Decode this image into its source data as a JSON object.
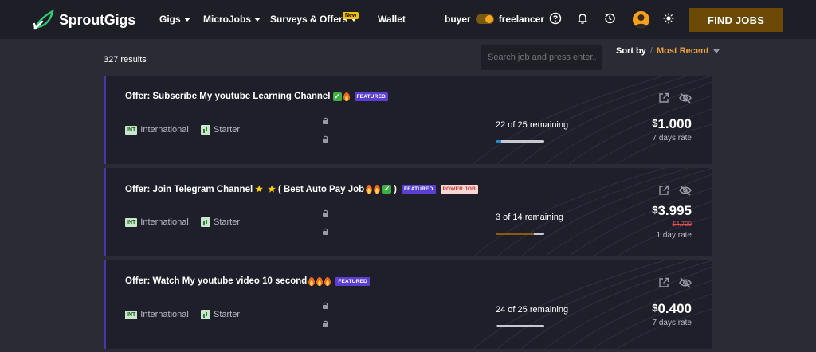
{
  "brand": {
    "name_part1": "Sprout",
    "name_part2": "Gigs"
  },
  "nav": [
    {
      "label": "Gigs",
      "dropdown": true
    },
    {
      "label": "MicroJobs",
      "dropdown": true
    },
    {
      "label": "Surveys & Offers",
      "dropdown": true,
      "badge": "New"
    },
    {
      "label": "Wallet",
      "dropdown": false
    }
  ],
  "mode_toggle": {
    "left_label": "buyer",
    "right_label": "freelancer",
    "active": "freelancer"
  },
  "header_icons": [
    "help-icon",
    "bell-icon",
    "history-icon",
    "avatar",
    "theme-sun-icon"
  ],
  "find_jobs_label": "FIND JOBS",
  "results_count": "327 results",
  "search": {
    "placeholder": "Search job and press enter..."
  },
  "sort": {
    "label": "Sort by",
    "separator": "/",
    "value": "Most Recent"
  },
  "colors": {
    "accent": "#e8a33a",
    "brand_green": "#2ecc71",
    "featured": "#5b3fd0",
    "find_jobs_bg": "#6b4a08"
  },
  "jobs": [
    {
      "title": "Offer: Subscribe My youtube Learning Channel",
      "title_emojis": [
        "check",
        "fire"
      ],
      "badges": [
        "FEATURED"
      ],
      "region_code": "INT",
      "region": "International",
      "level": "Starter",
      "remaining": "22 of 25 remaining",
      "progress": 0.12,
      "currency": "$",
      "price": "1.000",
      "old_price": "",
      "rate": "7 days rate"
    },
    {
      "title": "Offer: Join Telegram Channel",
      "title_suffix": "( Best Auto Pay Job",
      "title_close": ")",
      "title_emojis": [
        "star",
        "star",
        "fire",
        "fire",
        "check"
      ],
      "badges": [
        "FEATURED",
        "POWER JOB"
      ],
      "region_code": "INT",
      "region": "International",
      "level": "Starter",
      "remaining": "3 of 14 remaining",
      "progress": 0.79,
      "currency": "$",
      "price": "3.995",
      "old_price": "$4.700",
      "rate": "1 day rate"
    },
    {
      "title": "Offer: Watch My youtube video 10 second",
      "title_emojis": [
        "fire",
        "fire",
        "fire"
      ],
      "badges": [
        "FEATURED"
      ],
      "region_code": "INT",
      "region": "International",
      "level": "Starter",
      "remaining": "24 of 25 remaining",
      "progress": 0.04,
      "currency": "$",
      "price": "0.400",
      "old_price": "",
      "rate": "7 days rate"
    }
  ]
}
